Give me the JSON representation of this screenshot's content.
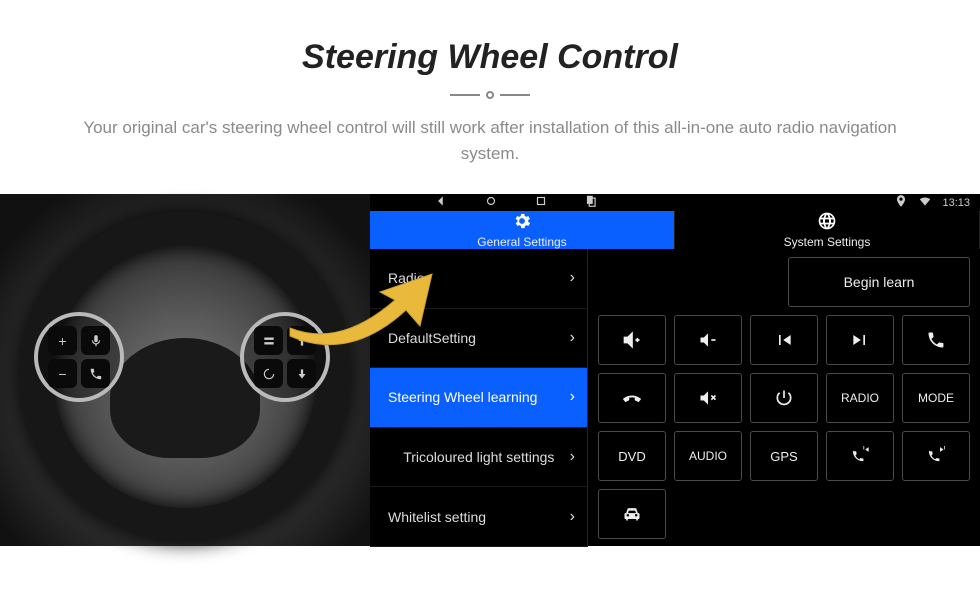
{
  "hero": {
    "title": "Steering Wheel Control",
    "subtitle": "Your original car's steering wheel control will still work after installation of this all-in-one auto radio navigation system."
  },
  "statusbar": {
    "time": "13:13"
  },
  "tabs": {
    "general": "General Settings",
    "system": "System Settings"
  },
  "menu": {
    "radio": "Radio",
    "default": "DefaultSetting",
    "swc": "Steering Wheel learning",
    "tricolor": "Tricoloured light settings",
    "whitelist": "Whitelist setting"
  },
  "panel": {
    "begin": "Begin learn",
    "radio": "RADIO",
    "mode": "MODE",
    "dvd": "DVD",
    "audio": "AUDIO",
    "gps": "GPS"
  }
}
